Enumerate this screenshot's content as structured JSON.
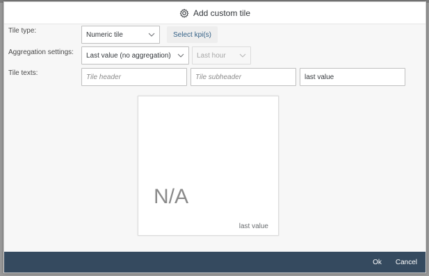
{
  "dialog": {
    "title": "Add custom tile",
    "header_icon": "gear-icon"
  },
  "form": {
    "tile_type": {
      "label": "Tile type:",
      "value": "Numeric tile",
      "kpi_button": "Select kpi(s)"
    },
    "aggregation": {
      "label": "Aggregation settings:",
      "value": "Last value (no aggregation)",
      "timeframe": "Last hour"
    },
    "tile_texts": {
      "label": "Tile texts:",
      "header_placeholder": "Tile header",
      "subheader_placeholder": "Tile subheader",
      "footer_value": "last value"
    }
  },
  "preview": {
    "value": "N/A",
    "footer": "last value"
  },
  "footer": {
    "ok_label": "Ok",
    "cancel_label": "Cancel"
  }
}
